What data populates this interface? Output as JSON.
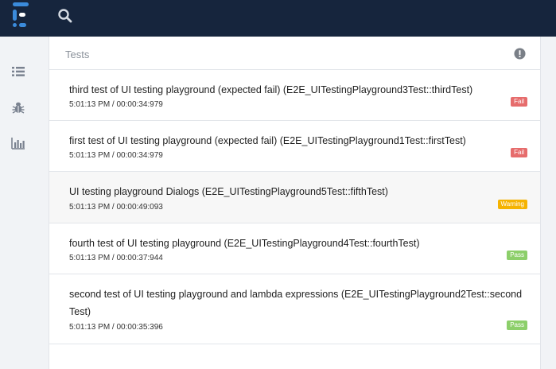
{
  "colors": {
    "topbar": "#16253d",
    "fail": "#e66c6c",
    "warning": "#f5b301",
    "pass": "#8ccf6a",
    "accent": "#3b8bdb"
  },
  "icons": {
    "logo": "extent-logo-icon",
    "search": "search-icon",
    "sidebar": [
      "list-icon",
      "bug-icon",
      "bar-chart-icon"
    ],
    "info": "info-icon"
  },
  "panel": {
    "title": "Tests"
  },
  "tests": [
    {
      "name": "third test of UI testing playground (expected fail) (E2E_UITestingPlayground3Test::thirdTest)",
      "meta": "5:01:13 PM / 00:00:34:979",
      "status": "Fail"
    },
    {
      "name": "first test of UI testing playground (expected fail) (E2E_UITestingPlayground1Test::firstTest)",
      "meta": "5:01:13 PM / 00:00:34:979",
      "status": "Fail"
    },
    {
      "name": "UI testing playground Dialogs (E2E_UITestingPlayground5Test::fifthTest)",
      "meta": "5:01:13 PM / 00:00:49:093",
      "status": "Warning"
    },
    {
      "name": "fourth test of UI testing playground (E2E_UITestingPlayground4Test::fourthTest)",
      "meta": "5:01:13 PM / 00:00:37:944",
      "status": "Pass"
    },
    {
      "name": "second test of UI testing playground and lambda expressions (E2E_UITestingPlayground2Test::secondTest)",
      "meta": "5:01:13 PM / 00:00:35:396",
      "status": "Pass"
    }
  ]
}
